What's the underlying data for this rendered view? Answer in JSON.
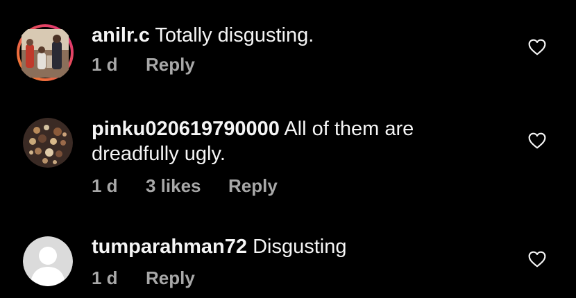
{
  "comments": [
    {
      "username": "anilr.c",
      "text": "Totally disgusting.",
      "time": "1 d",
      "likes": "",
      "reply_label": "Reply",
      "avatar_icon": "avatar-photo-family",
      "has_story_ring": true
    },
    {
      "username": "pinku020619790000",
      "text": "All of them are dreadfully ugly.",
      "time": "1 d",
      "likes": "3 likes",
      "reply_label": "Reply",
      "avatar_icon": "avatar-photo-ornament"
    },
    {
      "username": "tumparahman72",
      "text": "Disgusting",
      "time": "1 d",
      "likes": "",
      "reply_label": "Reply",
      "avatar_icon": "avatar-default-user"
    }
  ],
  "colors": {
    "background": "#000000",
    "text": "#f5f5f5",
    "meta": "#a8a8a8",
    "story_ring_start": "#f58529",
    "story_ring_end": "#dd2a7b"
  }
}
